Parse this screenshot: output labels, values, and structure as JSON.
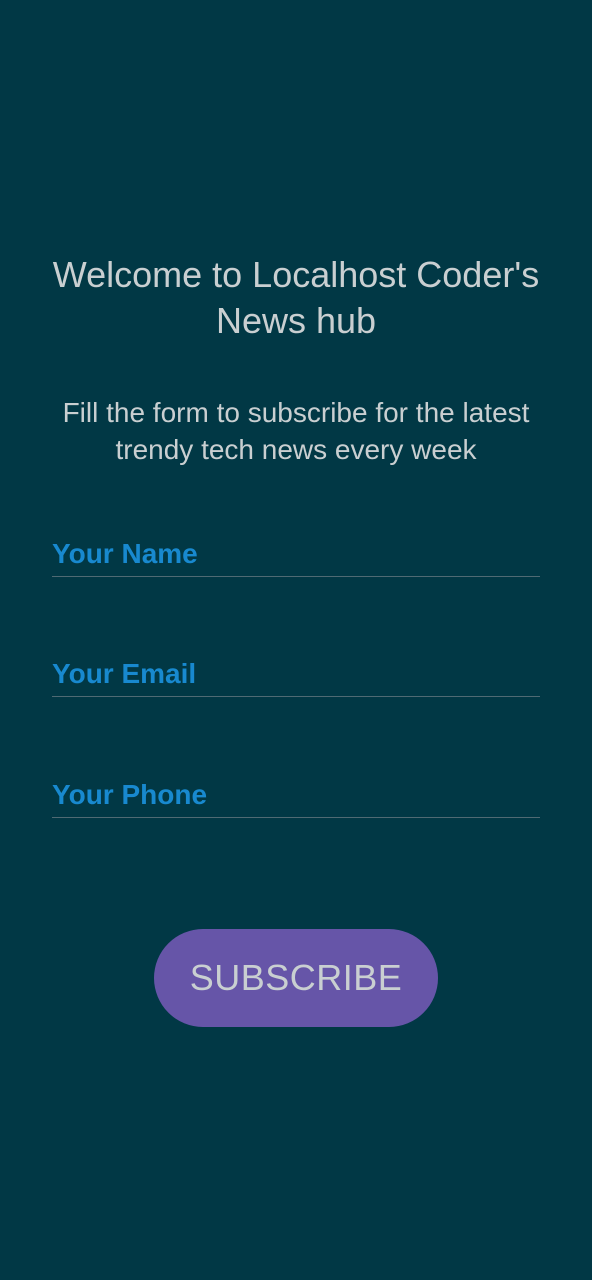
{
  "header": {
    "title": "Welcome to Localhost Coder's News hub",
    "subtitle": "Fill the form to subscribe for the latest trendy tech news every week"
  },
  "form": {
    "name_placeholder": "Your Name",
    "email_placeholder": "Your Email",
    "phone_placeholder": "Your Phone",
    "submit_label": "SUBSCRIBE"
  },
  "colors": {
    "background": "#013845",
    "text": "#c9cfd1",
    "placeholder": "#1889cf",
    "underline": "#4f6a73",
    "button": "#6655a8"
  }
}
